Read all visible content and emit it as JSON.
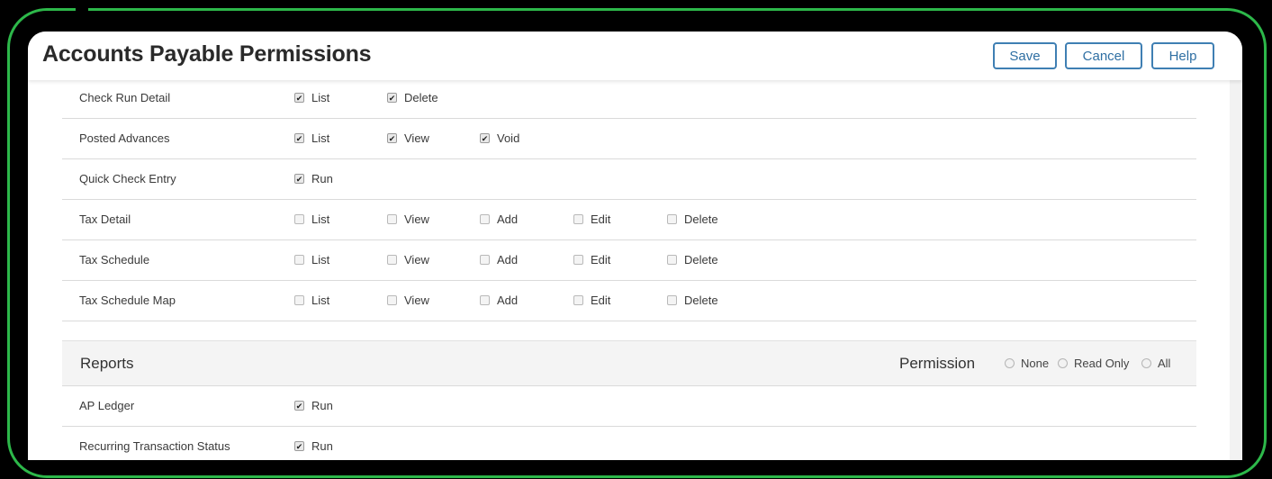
{
  "header": {
    "title": "Accounts Payable Permissions",
    "save_label": "Save",
    "cancel_label": "Cancel",
    "help_label": "Help"
  },
  "rows": [
    {
      "label": "Check Run Detail",
      "perms": [
        {
          "label": "List",
          "checked": true
        },
        {
          "label": "Delete",
          "checked": true
        }
      ]
    },
    {
      "label": "Posted Advances",
      "perms": [
        {
          "label": "List",
          "checked": true
        },
        {
          "label": "View",
          "checked": true
        },
        {
          "label": "Void",
          "checked": true
        }
      ]
    },
    {
      "label": "Quick Check Entry",
      "perms": [
        {
          "label": "Run",
          "checked": true
        }
      ]
    },
    {
      "label": "Tax Detail",
      "perms": [
        {
          "label": "List",
          "checked": false
        },
        {
          "label": "View",
          "checked": false
        },
        {
          "label": "Add",
          "checked": false
        },
        {
          "label": "Edit",
          "checked": false
        },
        {
          "label": "Delete",
          "checked": false
        }
      ]
    },
    {
      "label": "Tax Schedule",
      "perms": [
        {
          "label": "List",
          "checked": false
        },
        {
          "label": "View",
          "checked": false
        },
        {
          "label": "Add",
          "checked": false
        },
        {
          "label": "Edit",
          "checked": false
        },
        {
          "label": "Delete",
          "checked": false
        }
      ]
    },
    {
      "label": "Tax Schedule Map",
      "perms": [
        {
          "label": "List",
          "checked": false
        },
        {
          "label": "View",
          "checked": false
        },
        {
          "label": "Add",
          "checked": false
        },
        {
          "label": "Edit",
          "checked": false
        },
        {
          "label": "Delete",
          "checked": false
        }
      ]
    }
  ],
  "reports": {
    "title": "Reports",
    "permission_label": "Permission",
    "options": [
      "None",
      "Read Only",
      "All"
    ],
    "rows": [
      {
        "label": "AP Ledger",
        "perms": [
          {
            "label": "Run",
            "checked": true
          }
        ]
      },
      {
        "label": "Recurring Transaction Status",
        "perms": [
          {
            "label": "Run",
            "checked": true
          }
        ]
      }
    ]
  },
  "colors": {
    "frame": "#2db84a",
    "button_border": "#3f7fb3",
    "button_text": "#2f6fa3",
    "section_bg": "#f4f4f4"
  }
}
